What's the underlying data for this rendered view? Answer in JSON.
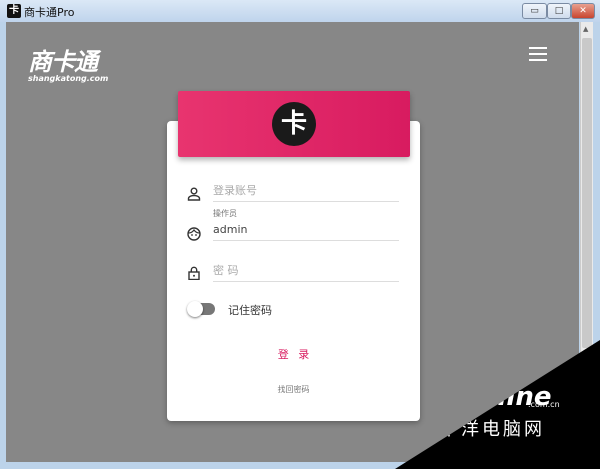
{
  "window": {
    "title": "商卡通Pro",
    "icon": "卡",
    "minimize": "▭",
    "maximize": "□",
    "close": "✕"
  },
  "brand": {
    "name": "商卡通",
    "domain": "shangkatong.com",
    "badge": "卡"
  },
  "form": {
    "account_placeholder": "登录账号",
    "operator_label": "操作员",
    "operator_value": "admin",
    "password_placeholder": "密 码",
    "remember_label": "记住密码",
    "remember_on": false,
    "login_label": "登 录",
    "forgot_label": "找回密码"
  },
  "watermark": {
    "brand": "PConline",
    "domain": ".com.cn",
    "cn": "太平洋电脑网"
  },
  "colors": {
    "accent": "#d81b60",
    "background": "#878787"
  }
}
